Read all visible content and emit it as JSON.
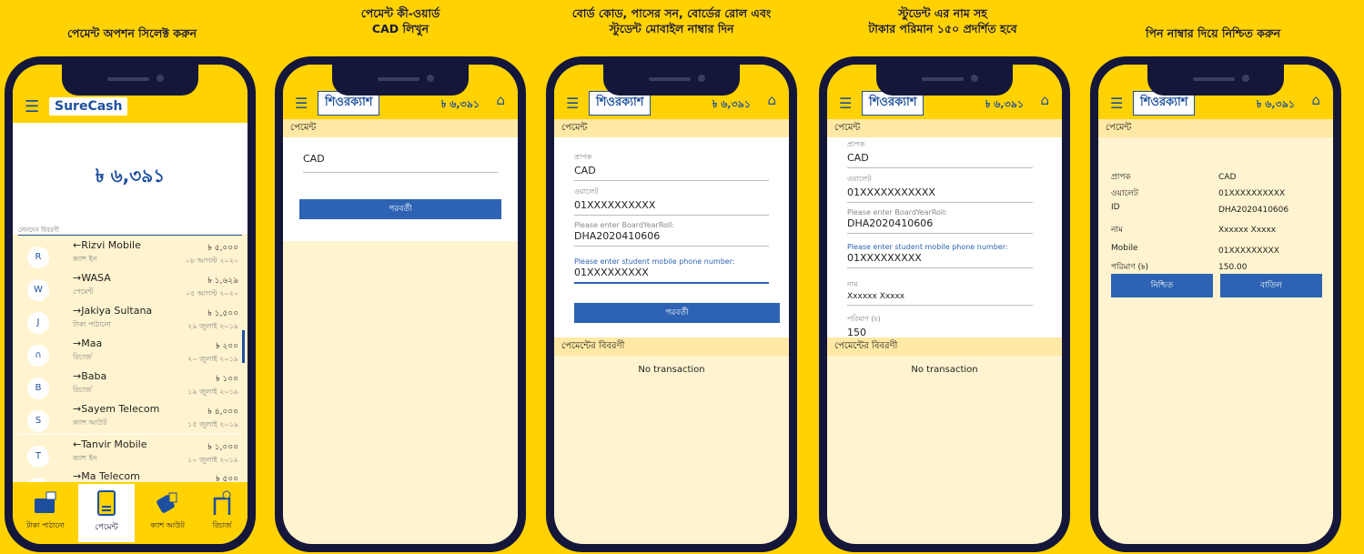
{
  "colors": {
    "background": "#FFD200",
    "accent": "#1d4f9f",
    "button": "#2d63b2",
    "panel": "#FFF4CF"
  },
  "captions": [
    "পেমেন্ট অপশন সিলেক্ট করুন",
    "পেমেন্ট কী-ওয়ার্ড\nCAD লিখুন",
    "বোর্ড কোড, পাসের সন, বোর্ডের রোল এবং\nস্টুডেন্ট মোবাইল নাম্বার দিন",
    "স্টুডেন্ট এর নাম সহ\nটাকার পরিমান ১৫০ প্রদর্শিত হবে",
    "পিন নাম্বার দিয়ে নিশ্চিত করুন"
  ],
  "screen1": {
    "logo": "SureCash",
    "balance": "৳ ৬,৩৯১",
    "list_title": "লেনদেন বিবরণী",
    "transactions": [
      {
        "avatar": "R",
        "name": "←Rizvi Mobile",
        "type": "ক্যাশ ইন",
        "amount": "৳ ৫,০০০",
        "date": "০৮ আগস্ট ২০২০"
      },
      {
        "avatar": "W",
        "name": "→WASA",
        "type": "পেমেন্ট",
        "amount": "৳ ১,৬২৯",
        "date": "০৫ আগস্ট ২০২০"
      },
      {
        "avatar": "J",
        "name": "→Jakiya Sultana",
        "type": "টাকা পাঠানো",
        "amount": "৳ ১,৫০০",
        "date": "২৯ জুলাই ২০১৯"
      },
      {
        "avatar": "∩",
        "name": "→Maa",
        "type": "রিচার্জ",
        "amount": "৳ ২০০",
        "date": "২০ জুলাই ২০১৯"
      },
      {
        "avatar": "B",
        "name": "→Baba",
        "type": "রিচার্জ",
        "amount": "৳ ১০০",
        "date": "১৯ জুলাই ২০১৯"
      },
      {
        "avatar": "S",
        "name": "→Sayem Telecom",
        "type": "ক্যাশ আউট",
        "amount": "৳ ৪,০০০",
        "date": "১৫ জুলাই ২০১৯"
      },
      {
        "avatar": "T",
        "name": "←Tanvir Mobile",
        "type": "ক্যাশ ইন",
        "amount": "৳ ১,০০০",
        "date": "১০ জুলাই ২০১৯"
      },
      {
        "avatar": "M",
        "name": "→Ma Telecom",
        "type": "",
        "amount": "৳ ৫০০",
        "date": ""
      }
    ],
    "tabs": [
      "টাকা পাঠানো",
      "পেমেন্ট",
      "ক্যাশ আউট",
      "রিচার্জ"
    ]
  },
  "common": {
    "logo": "শিওরক্যাশ",
    "balance": "৳ ৬,৩৯১",
    "subtitle": "পেমেন্ট",
    "next": "পরবর্তী",
    "details": "পেমেন্টের বিবরণী",
    "no_tx": "No transaction"
  },
  "screen2": {
    "keyword": "CAD"
  },
  "screen3": {
    "fields": [
      {
        "label": "প্রাপক",
        "value": "CAD"
      },
      {
        "label": "ওয়ালেট",
        "value": "01XXXXXXXXXX"
      },
      {
        "label": "Please enter BoardYearRoll:",
        "value": "DHA2020410606"
      },
      {
        "label": "Please enter student mobile phone number:",
        "value": "01XXXXXXXXX"
      }
    ]
  },
  "screen4": {
    "fields": [
      {
        "label": "প্রাপক",
        "value": "CAD"
      },
      {
        "label": "ওয়ালেট",
        "value": "01XXXXXXXXXXX"
      },
      {
        "label": "Please enter BoardYearRoll:",
        "value": "DHA2020410606"
      },
      {
        "label": "Please enter student mobile phone number:",
        "value": "01XXXXXXXXX"
      },
      {
        "label": "নাম",
        "value": "Xxxxxx Xxxxx"
      },
      {
        "label": "পরিমাণ (৳)",
        "value": "150"
      }
    ]
  },
  "screen5": {
    "rows": [
      {
        "k": "প্রাপক",
        "v": "CAD"
      },
      {
        "k": "ওয়ালেট",
        "v": "01XXXXXXXXXX"
      },
      {
        "k": "ID",
        "v": "DHA2020410606"
      },
      {
        "k": "নাম",
        "v": "Xxxxxx Xxxxx"
      },
      {
        "k": "Mobile",
        "v": "01XXXXXXXXX"
      },
      {
        "k": "পরিমাণ (৳)",
        "v": "150.00"
      }
    ],
    "confirm": "নিশ্চিত",
    "cancel": "বাতিল"
  }
}
